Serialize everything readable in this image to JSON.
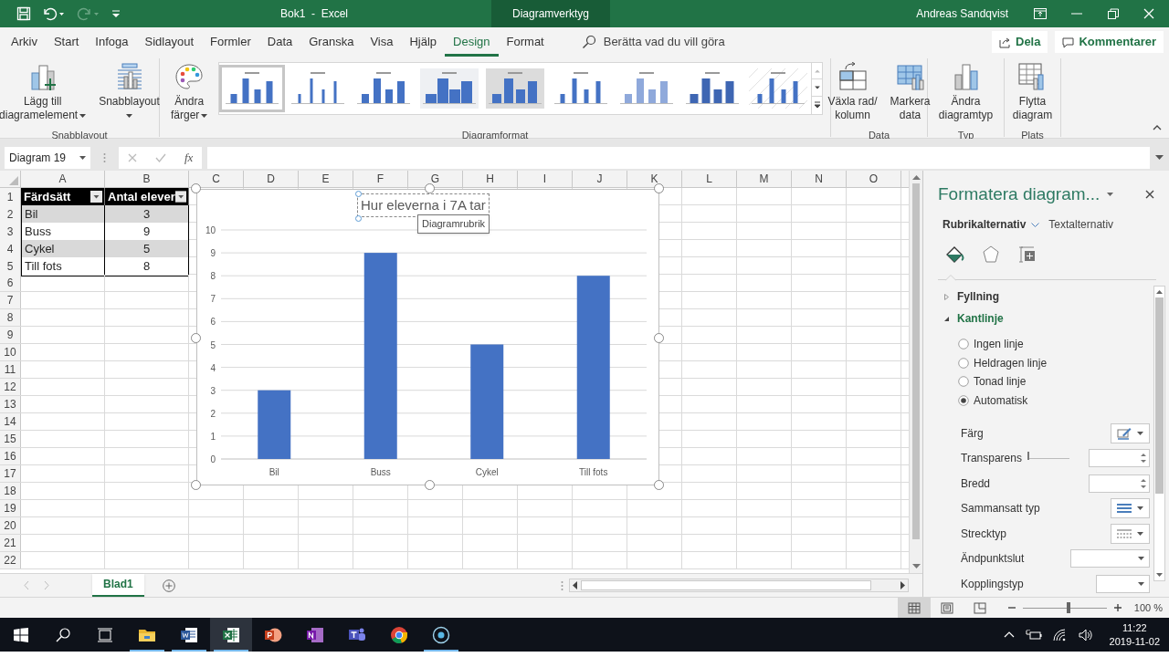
{
  "window": {
    "title": "Bok1  -  Excel",
    "context_title": "Diagramverktyg",
    "user": "Andreas Sandqvist"
  },
  "ribbon_tabs": [
    {
      "label": "Arkiv",
      "selected": false
    },
    {
      "label": "Start",
      "selected": false
    },
    {
      "label": "Infoga",
      "selected": false
    },
    {
      "label": "Sidlayout",
      "selected": false
    },
    {
      "label": "Formler",
      "selected": false
    },
    {
      "label": "Data",
      "selected": false
    },
    {
      "label": "Granska",
      "selected": false
    },
    {
      "label": "Visa",
      "selected": false
    },
    {
      "label": "Hjälp",
      "selected": false
    },
    {
      "label": "Design",
      "selected": true
    },
    {
      "label": "Format",
      "selected": false
    }
  ],
  "tell_me": {
    "placeholder": "Berätta vad du vill göra"
  },
  "share_buttons": [
    "Dela",
    "Kommentarer"
  ],
  "ribbon_groups": [
    {
      "label": "Snabblayout",
      "buttons": [
        {
          "kind": "add-element",
          "lines": [
            "Lägg till",
            "diagramelement"
          ],
          "dropdown": true
        },
        {
          "kind": "quick-layout",
          "lines": [
            "Snabblayout"
          ],
          "dropdown": true
        }
      ]
    },
    {
      "label": "Diagramformat",
      "buttons": [
        {
          "kind": "colors",
          "lines": [
            "Ändra",
            "färger"
          ],
          "dropdown": true
        }
      ],
      "gallery": [
        {
          "selected": true
        },
        {
          "selected": false
        },
        {
          "selected": false
        },
        {
          "selected": false
        },
        {
          "selected": false
        },
        {
          "selected": false
        },
        {
          "selected": false
        },
        {
          "selected": false
        },
        {
          "selected": false
        }
      ]
    },
    {
      "label": "Data",
      "buttons": [
        {
          "kind": "switch",
          "lines": [
            "Växla rad/",
            "kolumn"
          ],
          "dropdown": false
        },
        {
          "kind": "select-data",
          "lines": [
            "Markera",
            "data"
          ],
          "dropdown": false
        }
      ]
    },
    {
      "label": "Typ",
      "buttons": [
        {
          "kind": "chart-type",
          "lines": [
            "Ändra",
            "diagramtyp"
          ],
          "dropdown": false
        }
      ]
    },
    {
      "label": "Plats",
      "buttons": [
        {
          "kind": "move",
          "lines": [
            "Flytta",
            "diagram"
          ],
          "dropdown": false
        }
      ]
    }
  ],
  "formula_bar": {
    "name_box": "Diagram 19",
    "fx": "fx"
  },
  "sheet": {
    "columns": [
      "A",
      "B",
      "C",
      "D",
      "E",
      "F",
      "G",
      "H",
      "I",
      "J",
      "K",
      "L",
      "M",
      "N",
      "O"
    ],
    "rows": [
      "1",
      "2",
      "3",
      "4",
      "5",
      "6",
      "7",
      "8",
      "9",
      "10",
      "11",
      "12",
      "13",
      "14",
      "15",
      "16",
      "17",
      "18",
      "19",
      "20",
      "21",
      "22"
    ],
    "table": {
      "headers": [
        "Färdsätt",
        "Antal elever"
      ],
      "rows": [
        [
          "Bil",
          "3"
        ],
        [
          "Buss",
          "9"
        ],
        [
          "Cykel",
          "5"
        ],
        [
          "Till fots",
          "8"
        ]
      ]
    }
  },
  "chart": {
    "tooltip": "Diagramrubrik",
    "chart_data": {
      "type": "bar",
      "title": "Hur eleverna i 7A tar",
      "categories": [
        "Bil",
        "Buss",
        "Cykel",
        "Till fots"
      ],
      "values": [
        3,
        9,
        5,
        8
      ],
      "grid": true,
      "ylim": [
        0,
        10
      ],
      "yticks": [
        0,
        1,
        2,
        3,
        4,
        5,
        6,
        7,
        8,
        9,
        10
      ]
    }
  },
  "sheet_tabs": [
    {
      "label": "Blad1",
      "selected": true
    }
  ],
  "format_pane": {
    "title": "Formatera diagram...",
    "tabs": [
      {
        "label": "Rubrikalternativ",
        "selected": true
      },
      {
        "label": "Textalternativ",
        "selected": false
      }
    ],
    "icon_tabs": [
      {
        "kind": "fill",
        "selected": true
      },
      {
        "kind": "effects",
        "selected": false
      },
      {
        "kind": "size",
        "selected": false
      }
    ],
    "sections": [
      {
        "label": "Fyllning",
        "expanded": false
      },
      {
        "label": "Kantlinje",
        "expanded": true,
        "options": [
          {
            "label": "Ingen linje",
            "selected": false
          },
          {
            "label": "Heldragen linje",
            "selected": false
          },
          {
            "label": "Tonad linje",
            "selected": false
          },
          {
            "label": "Automatisk",
            "selected": true
          }
        ],
        "properties": [
          {
            "label": "Färg",
            "kind": "color"
          },
          {
            "label": "Transparens",
            "kind": "slider",
            "level": 0
          },
          {
            "label": "Bredd",
            "kind": "spin"
          },
          {
            "label": "Sammansatt typ",
            "kind": "compound"
          },
          {
            "label": "Strecktyp",
            "kind": "dash"
          },
          {
            "label": "Ändpunktslut",
            "kind": "wide-dropdown"
          },
          {
            "label": "Kopplingstyp",
            "kind": "dropdown"
          }
        ]
      }
    ]
  },
  "status_bar": {
    "views": [
      {
        "kind": "normal",
        "selected": true
      },
      {
        "kind": "page-layout",
        "selected": false
      },
      {
        "kind": "page-break",
        "selected": false
      }
    ],
    "zoom": {
      "level": 0.55,
      "label": "100 %"
    }
  },
  "taskbar": {
    "apps": [
      {
        "kind": "start",
        "running": false,
        "selected": false
      },
      {
        "kind": "search",
        "running": false,
        "selected": false
      },
      {
        "kind": "task-view",
        "running": false,
        "selected": false
      },
      {
        "kind": "explorer",
        "running": true,
        "selected": false
      },
      {
        "kind": "word",
        "running": true,
        "selected": false
      },
      {
        "kind": "excel",
        "running": true,
        "selected": true
      },
      {
        "kind": "powerpoint",
        "running": false,
        "selected": false
      },
      {
        "kind": "onenote",
        "running": false,
        "selected": false
      },
      {
        "kind": "teams",
        "running": false,
        "selected": false
      },
      {
        "kind": "chrome",
        "running": false,
        "selected": false
      },
      {
        "kind": "recorder",
        "running": true,
        "selected": false
      }
    ],
    "time": "11:22",
    "date": "2019-11-02"
  }
}
